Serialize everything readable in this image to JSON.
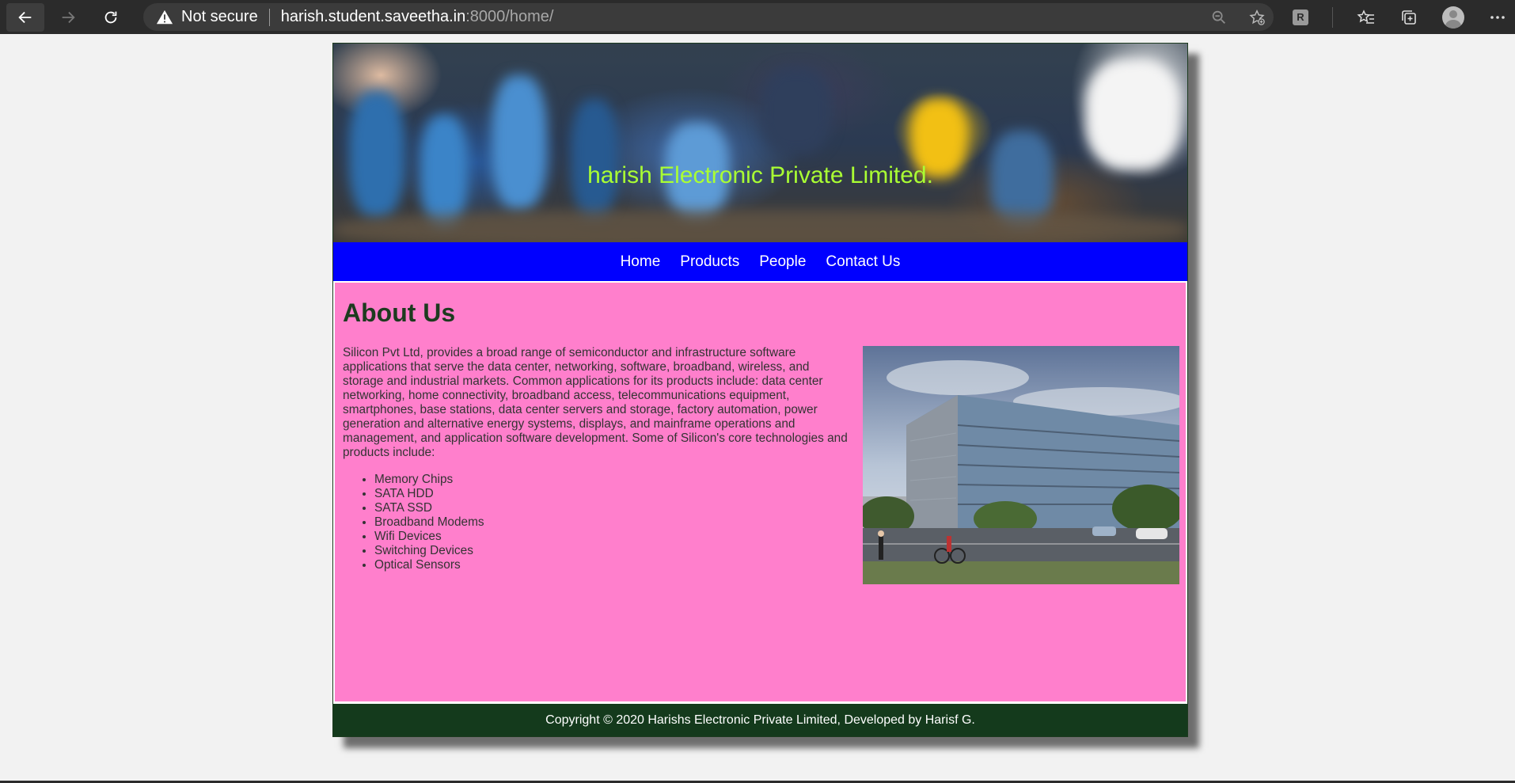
{
  "browser": {
    "security_label": "Not secure",
    "url_host": "harish.student.saveetha.in",
    "url_rest": ":8000/home/",
    "extension_letter": "R"
  },
  "site": {
    "banner_title": "harish Electronic Private Limited.",
    "menu": [
      "Home",
      "Products",
      "People",
      "Contact Us"
    ],
    "heading": "About Us",
    "paragraph": "Silicon Pvt Ltd, provides a broad range of semiconductor and infrastructure software applications that serve the data center, networking, software, broadband, wireless, and storage and industrial markets. Common applications for its products include: data center networking, home connectivity, broadband access, telecommunications equipment, smartphones, base stations, data center servers and storage, factory automation, power generation and alternative energy systems, displays, and mainframe operations and management, and application software development. Some of Silicon's core technologies and products include:",
    "products": [
      "Memory Chips",
      "SATA HDD",
      "SATA SSD",
      "Broadband Modems",
      "Wifi Devices",
      "Switching Devices",
      "Optical Sensors"
    ],
    "footer": "Copyright © 2020 Harishs Electronic Private Limited, Developed by Harisf G."
  },
  "colors": {
    "banner_title": "#aaff33",
    "menu_bg": "#0000ff",
    "content_bg": "#ff7fcc",
    "heading": "#1d3b1f",
    "footer_bg": "#143a1c"
  },
  "icons": [
    "back-arrow-icon",
    "forward-arrow-icon",
    "refresh-icon",
    "warning-icon",
    "zoom-out-icon",
    "add-favorite-icon",
    "extension-icon",
    "favorites-icon",
    "collections-icon",
    "profile-avatar",
    "more-icon"
  ]
}
